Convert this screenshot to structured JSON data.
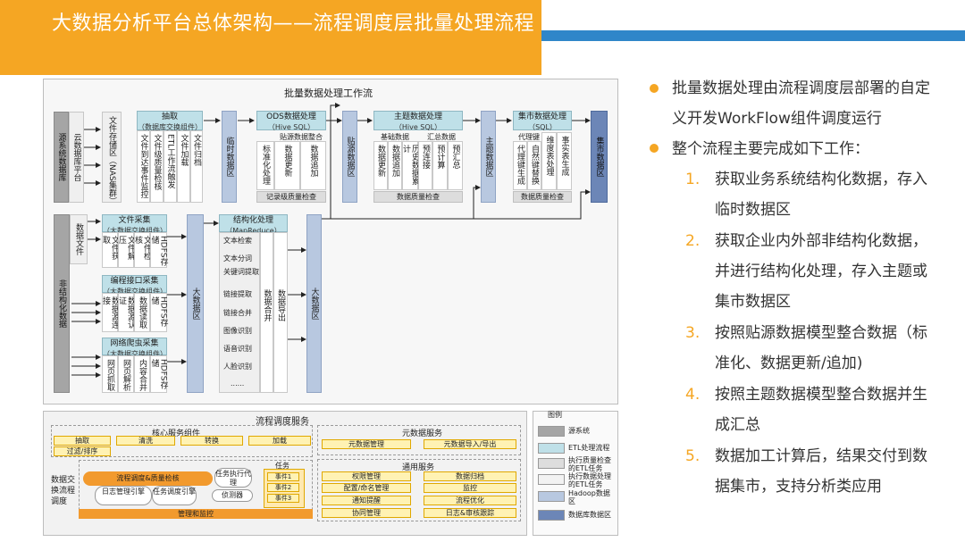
{
  "title": "大数据分析平台总体架构——流程调度层批量处理流程",
  "wf": {
    "title": "批量数据处理工作流",
    "source_sys": "源系统数据库",
    "cloud_platform": "云数据库平台",
    "file_storage": "文件存储区（NAS集群）",
    "extract": {
      "title": "抽取",
      "sub": "（数据库交换组件）",
      "cols": [
        "文件到达事件监控",
        "文件级质量检核",
        "ETL工作流触发",
        "文件加载",
        "文件归档"
      ]
    },
    "temp_zone": "临时数据区",
    "ods": {
      "title": "ODS数据处理",
      "sub": "（Hive SQL）",
      "mid": "贴源数据整合",
      "cols": [
        "标准化处理",
        "数据更新",
        "数据追加"
      ],
      "foot": "记录级质量检查"
    },
    "paste_zone": "贴源数据区",
    "subject_proc": {
      "title": "主题数据处理",
      "sub": "（Hive SQL）",
      "groups": [
        "基础数据",
        "汇总数据"
      ],
      "cols": [
        "数据更新",
        "数据追加",
        "历史数据累计",
        "预连接",
        "预计算",
        "预汇总"
      ],
      "foot": "数据质量检查"
    },
    "subject_zone": "主题数据区",
    "mart_proc": {
      "title": "集市数据处理",
      "sub": "（SQL）",
      "groups": [
        "代理键"
      ],
      "cols": [
        "代理键生成",
        "自然键替换",
        "维度表处理",
        "事实表生成"
      ],
      "foot": "数据质量检查"
    },
    "mart_zone": "集市数据区",
    "data_files": "数据文件",
    "unstructured": "非结构化数据",
    "file_collect": {
      "title": "文件采集",
      "sub": "（大数据交换组件）",
      "cols": [
        "文件获取",
        "文件解压",
        "文件检核",
        "HDFS存储"
      ]
    },
    "api_collect": {
      "title": "编程接口采集",
      "sub": "（大数据交换组件）",
      "cols": [
        "数据源连接",
        "数据源认证",
        "数据读取",
        "HDFS存储"
      ]
    },
    "crawler": {
      "title": "网络爬虫采集",
      "sub": "（大数据交换组件）",
      "cols": [
        "网页抓取",
        "网页解析",
        "内容合并",
        "HDFS存储"
      ]
    },
    "bigdata_zone1": "大数据区",
    "structuring": {
      "title": "结构化处理",
      "sub": "（MapReduce）",
      "items": [
        "文本检索",
        "文本分词",
        "关键词提取",
        "链接提取",
        "链接合并",
        "图像识别",
        "语音识别",
        "人脸识别",
        "......"
      ],
      "cols": [
        "数据合并",
        "数据导出"
      ]
    },
    "bigdata_zone2": "大数据区"
  },
  "sched": {
    "title": "流程调度服务",
    "left_label": "数据交换流程调度",
    "core": {
      "title": "核心服务组件",
      "row1": [
        "抽取",
        "清洗",
        "转换",
        "加载"
      ],
      "row2": [
        "过滤/排序"
      ]
    },
    "mid": {
      "center": "流程调度&质量检核",
      "log": "日志管理引擎",
      "sched": "任务调度引擎",
      "agent": "任务执行代理",
      "monitor": "侦测器",
      "task": "任务",
      "task_items": [
        "事件1",
        "事件2",
        "事件3"
      ],
      "bottom": "管理和监控"
    },
    "meta": {
      "title": "元数据服务",
      "items": [
        "元数据管理",
        "元数据导入/导出"
      ]
    },
    "common": {
      "title": "通用服务",
      "items": [
        "权限管理",
        "数据归档",
        "配置/命名管理",
        "监控",
        "通知提醒",
        "流程优化",
        "协同管理",
        "日志&审核跟踪"
      ]
    }
  },
  "legend": {
    "title": "图例",
    "items": [
      {
        "label": "源系统",
        "color": "#A5A5A5"
      },
      {
        "label": "ETL处理流程",
        "color": "#BFE0E8"
      },
      {
        "label": "执行质量检查的ETL任务",
        "color": "#DDDDDD"
      },
      {
        "label": "执行数据处理的ETL任务",
        "color": "#F2F2F2"
      },
      {
        "label": "Hadoop数据区",
        "color": "#B8C8E0"
      },
      {
        "label": "数据库数据区",
        "color": "#6C86B7"
      }
    ]
  },
  "right": {
    "bullets": [
      "批量数据处理由流程调度层部署的自定义开发WorkFlow组件调度运行",
      "整个流程主要完成如下工作："
    ],
    "steps": [
      {
        "n": "1.",
        "text": "获取业务系统结构化数据，存入临时数据区"
      },
      {
        "n": "2.",
        "text": "获取企业内外部非结构化数据，并进行结构化处理，存入主题或集市数据区"
      },
      {
        "n": "3.",
        "text": "按照贴源数据模型整合数据（标准化、数据更新/追加)"
      },
      {
        "n": "4.",
        "text": "按照主题数据模型整合数据并生成汇总"
      },
      {
        "n": "5.",
        "text": "数据加工计算后，结果交付到数据集市，支持分析类应用"
      }
    ]
  },
  "colors": {
    "orange": "#F5A623",
    "blue": "#2F86C9",
    "db_blue": "#6C86B7",
    "hadoop": "#B8C8E0",
    "etl": "#BFE0E8"
  }
}
